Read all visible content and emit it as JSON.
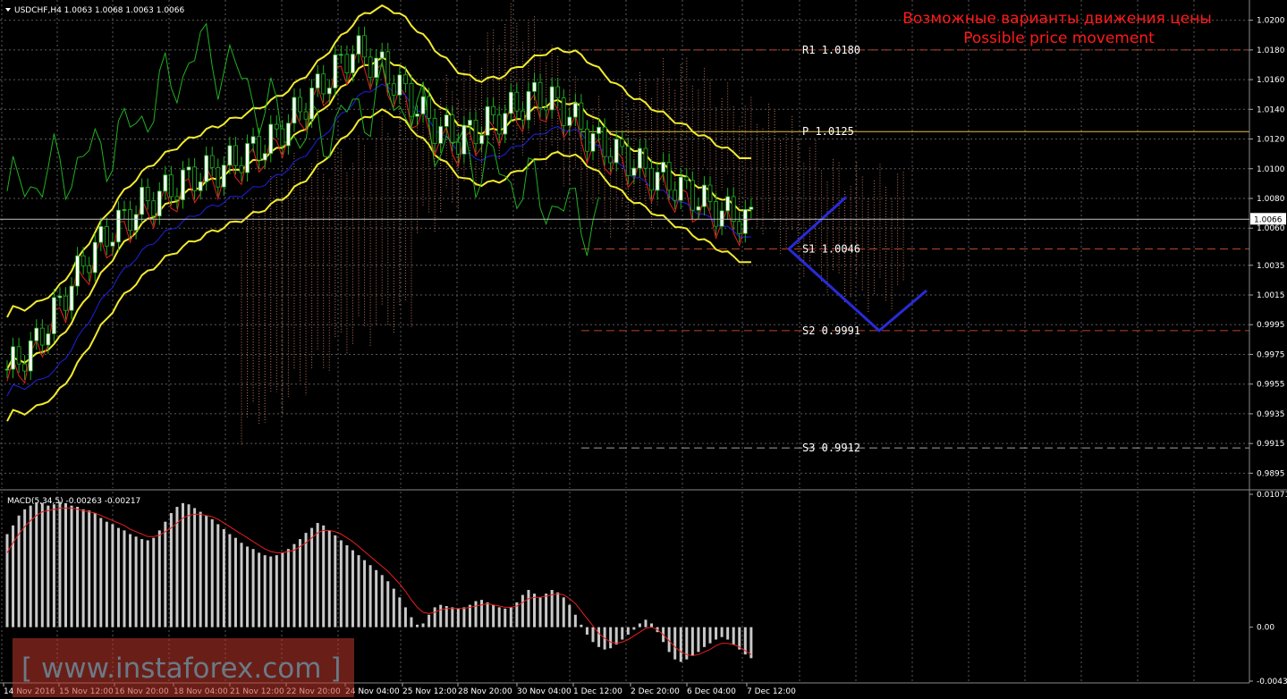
{
  "header": {
    "symbol_info": "USDCHF,H4  1.0063 1.0068 1.0063 1.0066"
  },
  "annotation": {
    "line1": "Возможные варианты движения цены",
    "line2": "Possible price movement"
  },
  "levels": [
    {
      "name": "R1",
      "text": "R1 1.0180",
      "value": 1.018,
      "style": "dashed",
      "color": "#b5452e"
    },
    {
      "name": "P",
      "text": "P 1.0125",
      "value": 1.0125,
      "style": "solid",
      "color": "#e8c040"
    },
    {
      "name": "S1",
      "text": "S1 1.0046",
      "value": 1.0046,
      "style": "dashed",
      "color": "#b5452e"
    },
    {
      "name": "S2",
      "text": "S2 0.9991",
      "value": 0.9991,
      "style": "dashed",
      "color": "#b5452e"
    },
    {
      "name": "S3",
      "text": "S3 0.9912",
      "value": 0.9912,
      "style": "dashed",
      "color": "#a0a0a0"
    }
  ],
  "current_price": {
    "text": "1.0066",
    "value": 1.0066
  },
  "price_axis": {
    "range": [
      0.9885,
      1.021
    ],
    "ticks": [
      "1.0200",
      "1.0180",
      "1.0160",
      "1.0140",
      "1.0120",
      "1.0100",
      "1.0080",
      "1.0060",
      "1.0035",
      "1.0015",
      "0.9995",
      "0.9975",
      "0.9955",
      "0.9935",
      "0.9915",
      "0.9895"
    ]
  },
  "macd": {
    "label": "MACD(5,34,5) -0.00263 -0.00217",
    "range": [
      -0.00435,
      0.01071
    ],
    "ticks": [
      "0.01071",
      "0.00",
      "-0.00435"
    ],
    "histogram": [
      0.0075,
      0.0082,
      0.009,
      0.0095,
      0.0098,
      0.01,
      0.01,
      0.0098,
      0.0099,
      0.0101,
      0.01,
      0.0098,
      0.0097,
      0.0095,
      0.0094,
      0.0092,
      0.0088,
      0.0085,
      0.0083,
      0.008,
      0.0078,
      0.0075,
      0.0073,
      0.0071,
      0.007,
      0.0072,
      0.0078,
      0.0085,
      0.0092,
      0.0097,
      0.01,
      0.0099,
      0.0096,
      0.0093,
      0.009,
      0.0087,
      0.0083,
      0.0079,
      0.0075,
      0.0072,
      0.0068,
      0.0065,
      0.0063,
      0.006,
      0.0058,
      0.0057,
      0.0058,
      0.006,
      0.0063,
      0.0067,
      0.0071,
      0.0076,
      0.008,
      0.0084,
      0.0082,
      0.0078,
      0.0074,
      0.007,
      0.0066,
      0.0062,
      0.0058,
      0.0054,
      0.005,
      0.0046,
      0.0042,
      0.0037,
      0.0031,
      0.0024,
      0.0016,
      0.0008,
      0.0002,
      0.0003,
      0.001,
      0.0016,
      0.0018,
      0.0017,
      0.0016,
      0.0015,
      0.0016,
      0.0018,
      0.0021,
      0.0022,
      0.002,
      0.0018,
      0.0016,
      0.0015,
      0.0016,
      0.002,
      0.0026,
      0.003,
      0.0027,
      0.0024,
      0.0027,
      0.003,
      0.0028,
      0.0024,
      0.0018,
      0.001,
      0.0002,
      -0.0006,
      -0.0012,
      -0.0016,
      -0.0018,
      -0.0017,
      -0.0014,
      -0.001,
      -0.0006,
      -0.0002,
      0.0003,
      0.0006,
      0.0003,
      -0.0004,
      -0.0012,
      -0.002,
      -0.0026,
      -0.0028,
      -0.0026,
      -0.0023,
      -0.002,
      -0.0016,
      -0.0013,
      -0.001,
      -0.0008,
      -0.001,
      -0.0014,
      -0.0018,
      -0.0022,
      -0.0025
    ],
    "signal": [
      0.006,
      0.0068,
      0.0075,
      0.0081,
      0.0086,
      0.009,
      0.0093,
      0.0094,
      0.0095,
      0.0096,
      0.0096,
      0.0096,
      0.0095,
      0.0094,
      0.0093,
      0.0092,
      0.009,
      0.0088,
      0.0086,
      0.0084,
      0.0082,
      0.0079,
      0.0077,
      0.0075,
      0.0073,
      0.0073,
      0.0074,
      0.0077,
      0.008,
      0.0084,
      0.0088,
      0.009,
      0.0091,
      0.0091,
      0.009,
      0.0089,
      0.0087,
      0.0084,
      0.0081,
      0.0078,
      0.0075,
      0.0072,
      0.0069,
      0.0066,
      0.0063,
      0.0061,
      0.006,
      0.006,
      0.0061,
      0.0062,
      0.0065,
      0.0068,
      0.0072,
      0.0076,
      0.0078,
      0.0078,
      0.0077,
      0.0075,
      0.0072,
      0.0069,
      0.0065,
      0.0061,
      0.0057,
      0.0053,
      0.0049,
      0.0045,
      0.004,
      0.0035,
      0.0029,
      0.0022,
      0.0016,
      0.0012,
      0.0011,
      0.0012,
      0.0014,
      0.0015,
      0.0015,
      0.0015,
      0.0015,
      0.0016,
      0.0017,
      0.0018,
      0.0019,
      0.0018,
      0.0017,
      0.0016,
      0.0016,
      0.0017,
      0.002,
      0.0023,
      0.0024,
      0.0024,
      0.0025,
      0.0026,
      0.0027,
      0.0026,
      0.0023,
      0.0019,
      0.0013,
      0.0007,
      0.0001,
      -0.0005,
      -0.0009,
      -0.0012,
      -0.0013,
      -0.0012,
      -0.001,
      -0.0007,
      -0.0004,
      -0.0001,
      0.0,
      -0.0002,
      -0.0006,
      -0.0011,
      -0.0016,
      -0.002,
      -0.0022,
      -0.0023,
      -0.0022,
      -0.002,
      -0.0018,
      -0.0015,
      -0.0013,
      -0.0013,
      -0.0014,
      -0.0016,
      -0.0019,
      -0.0022
    ]
  },
  "time_axis": [
    "14 Nov 2016",
    "15 Nov 12:00",
    "16 Nov 20:00",
    "18 Nov 04:00",
    "21 Nov 12:00",
    "22 Nov 20:00",
    "24 Nov 04:00",
    "25 Nov 12:00",
    "28 Nov 20:00",
    "30 Nov 04:00",
    "1 Dec 12:00",
    "2 Dec 20:00",
    "6 Dec 04:00",
    "7 Dec 12:00"
  ],
  "forecast_path": [
    [
      1.0046,
      null
    ],
    [
      1.0081,
      "up"
    ],
    [
      1.0046,
      "split"
    ],
    [
      0.9991,
      "down"
    ],
    [
      1.0018,
      "up"
    ]
  ],
  "colors": {
    "background": "#000000",
    "grid": "#5a5a5a",
    "bollinger": "#f2ea2e",
    "tenkan": "#e81f1f",
    "kijun": "#2020e0",
    "chikou": "#21b021",
    "cloud": "#e08a6a",
    "candle_bull": "#ffffff",
    "candle_bear": "#21b021",
    "macd_hist": "#c8c8c8",
    "macd_signal": "#e81f1f",
    "forecast": "#2a2ad8"
  },
  "watermark": {
    "text": "[ www.instaforex.com ]"
  }
}
